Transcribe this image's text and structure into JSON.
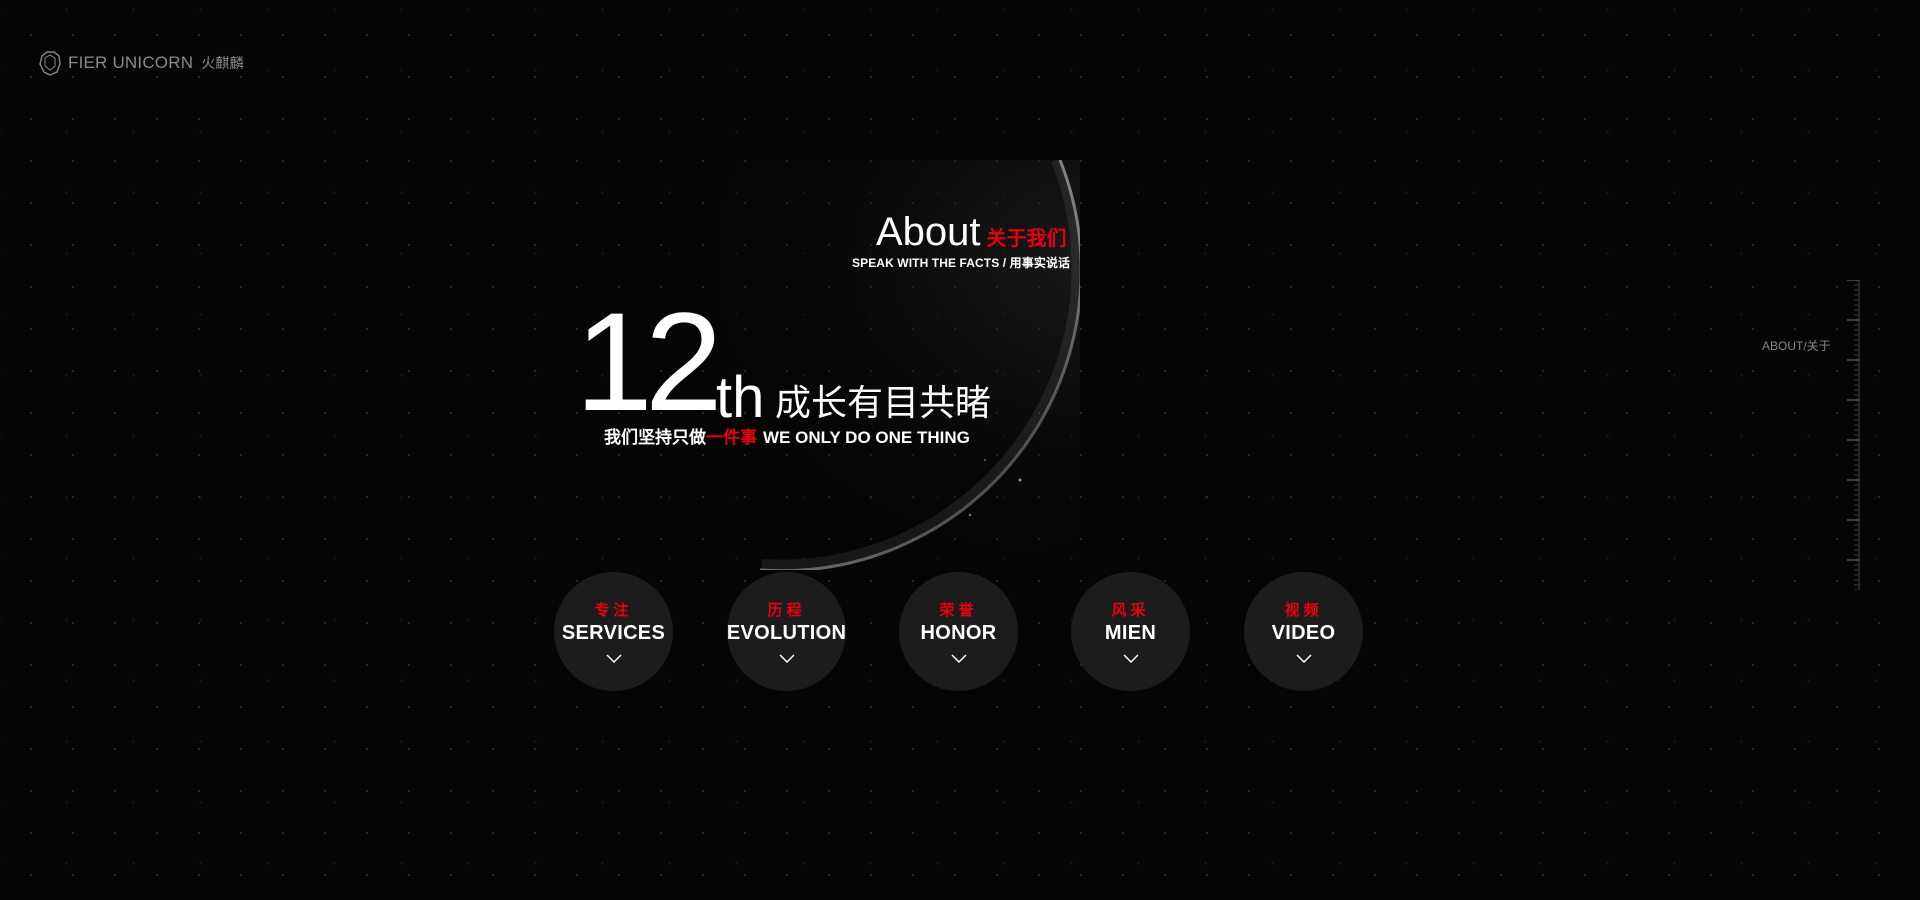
{
  "brand": {
    "name": "FIER UNICORN",
    "name_cn": "火麒麟",
    "icon": "unicorn-logo-icon"
  },
  "about": {
    "title_en": "About",
    "title_cn": "关于我们",
    "subtitle": "SPEAK WITH THE FACTS / 用事实说话"
  },
  "highlight": {
    "number": "12",
    "suffix": "th",
    "headline_cn": "成长有目共睹",
    "tagline_cn_prefix": "我们坚持只做",
    "tagline_cn_highlight": "一件事",
    "tagline_en": "WE ONLY DO ONE THING"
  },
  "nav_circles": [
    {
      "cn": "专注",
      "en": "SERVICES",
      "icon": "chevron-down-icon"
    },
    {
      "cn": "历程",
      "en": "EVOLUTION",
      "icon": "chevron-down-icon"
    },
    {
      "cn": "荣誉",
      "en": "HONOR",
      "icon": "chevron-down-icon"
    },
    {
      "cn": "风采",
      "en": "MIEN",
      "icon": "chevron-down-icon"
    },
    {
      "cn": "视频",
      "en": "VIDEO",
      "icon": "chevron-down-icon"
    }
  ],
  "side_nav": {
    "current_label": "ABOUT/关于"
  },
  "colors": {
    "background": "#050505",
    "accent": "#e60012",
    "circle": "#1c1c1c",
    "text": "#ffffff",
    "muted": "#8a8a8a"
  }
}
